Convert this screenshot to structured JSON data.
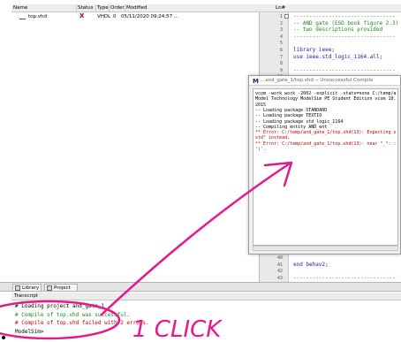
{
  "project": {
    "columns": [
      "Name",
      "Status",
      "Type",
      "Order",
      "Modified"
    ],
    "rows": [
      {
        "name": "top.vhd",
        "status": "X",
        "type": "VHDL",
        "order": "0",
        "modified": "05/11/2020 09:24:57 ..."
      }
    ]
  },
  "editor": {
    "header": "Ln#",
    "lines": [
      {
        "n": "1",
        "text": "--------------------------------",
        "cls": "c-green"
      },
      {
        "n": "2",
        "text": "-- AND gate (ESD book figure 2.3)",
        "cls": "c-green"
      },
      {
        "n": "3",
        "text": "-- two descriptions provided",
        "cls": "c-green"
      },
      {
        "n": "4",
        "text": "--------------------------------",
        "cls": "c-green"
      },
      {
        "n": "5",
        "text": "",
        "cls": ""
      },
      {
        "n": "6",
        "text": "library ieee;",
        "cls": "c-blue"
      },
      {
        "n": "7",
        "text": "use ieee.std_logic_1164.all;",
        "cls": "c-blue"
      },
      {
        "n": "8",
        "text": "",
        "cls": ""
      },
      {
        "n": "9",
        "text": "--------------------------------",
        "cls": "c-green"
      },
      {
        "n": "10",
        "text": "",
        "cls": ""
      }
    ],
    "bottom_lines": [
      {
        "n": "40",
        "text": "",
        "cls": ""
      },
      {
        "n": "41",
        "text": "end behav2;",
        "cls": "c-blue"
      },
      {
        "n": "42",
        "text": "",
        "cls": ""
      },
      {
        "n": "43",
        "text": "--------------------------------",
        "cls": "c-green"
      }
    ]
  },
  "dialog": {
    "title": "...and_gate_1/top.vhd -- Unsuccessful Compile",
    "lines": [
      {
        "text": "vcom -work work -2002 -explicit -stats=none C:/temp/a",
        "cls": ""
      },
      {
        "text": "Model Technology ModelSim PE Student Edition vcom 10.",
        "cls": ""
      },
      {
        "text": "2015",
        "cls": ""
      },
      {
        "text": "-- Loading package STANDARD",
        "cls": ""
      },
      {
        "text": "-- Loading package TEXTIO",
        "cls": ""
      },
      {
        "text": "-- Loading package std_logic_1164",
        "cls": ""
      },
      {
        "text": "-- Compiling entity AND_ent",
        "cls": ""
      },
      {
        "text": "** Error: C:/temp/and_gate_1/top.vhd(13): Expecting s",
        "cls": "c-red"
      },
      {
        "text": "std\" instead.",
        "cls": "c-red"
      },
      {
        "text": "** Error: C:/temp/and_gate_1/top.vhd(13): near \"_\": :",
        "cls": "c-red"
      },
      {
        "text": " ')'.",
        "cls": "c-red"
      }
    ]
  },
  "tabs": {
    "library": "Library",
    "project": "Project"
  },
  "transcript": {
    "title": "Transcript",
    "lines": [
      {
        "text": "# Loading project and_gate_1",
        "cls": ""
      },
      {
        "text": "# Compile of top.vhd was successful.",
        "cls": "c-green"
      },
      {
        "text": "# Compile of top.vhd failed with 2 errors.",
        "cls": "c-red"
      },
      {
        "text": "ModelSim>",
        "cls": ""
      }
    ]
  },
  "annotation": {
    "label": "1 CLICK",
    "color": "#e6198c"
  }
}
